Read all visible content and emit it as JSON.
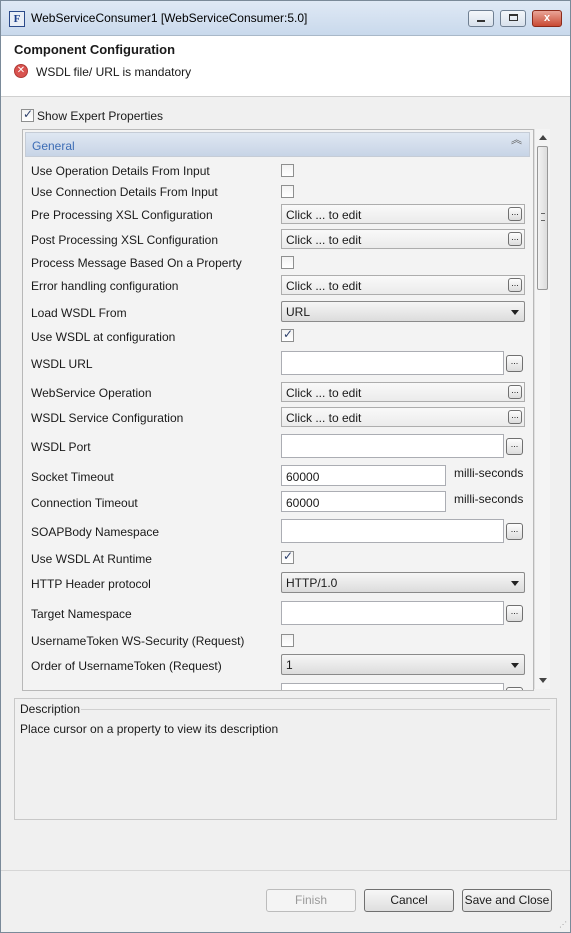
{
  "window": {
    "title": "WebServiceConsumer1 [WebServiceConsumer:5.0]",
    "app_icon_letter": "F",
    "controls": {
      "minimize": "minimize",
      "maximize": "maximize",
      "close": "x"
    }
  },
  "header": {
    "title": "Component Configuration",
    "error_message": "WSDL file/ URL is mandatory",
    "error_icon": "error-x-icon"
  },
  "expert": {
    "label": "Show Expert Properties",
    "checked": true
  },
  "section": {
    "title": "General",
    "collapse_icon": "double-chevron-up-icon"
  },
  "properties": [
    {
      "label": "Use Operation Details From Input",
      "type": "checkbox",
      "checked": false
    },
    {
      "label": "Use Connection Details From Input",
      "type": "checkbox",
      "checked": false
    },
    {
      "label": "Pre Processing XSL Configuration",
      "type": "edit",
      "value": "Click ... to edit"
    },
    {
      "label": "Post Processing XSL Configuration",
      "type": "edit",
      "value": "Click ... to edit"
    },
    {
      "label": "Process Message Based On a Property",
      "type": "checkbox",
      "checked": false
    },
    {
      "label": "Error handling configuration",
      "type": "edit",
      "value": "Click ... to edit"
    },
    {
      "label": "Load WSDL From",
      "type": "select",
      "value": "URL"
    },
    {
      "label": "Use WSDL at configuration",
      "type": "checkbox",
      "checked": true
    },
    {
      "label": "WSDL URL",
      "type": "text",
      "value": ""
    },
    {
      "label": "WebService Operation",
      "type": "edit",
      "value": "Click ... to edit"
    },
    {
      "label": "WSDL Service Configuration",
      "type": "edit",
      "value": "Click ... to edit"
    },
    {
      "label": "WSDL Port",
      "type": "text",
      "value": ""
    },
    {
      "label": "Socket Timeout",
      "type": "number",
      "value": "60000",
      "unit": "milli-seconds"
    },
    {
      "label": "Connection Timeout",
      "type": "number",
      "value": "60000",
      "unit": "milli-seconds"
    },
    {
      "label": "SOAPBody Namespace",
      "type": "text",
      "value": ""
    },
    {
      "label": "Use WSDL At Runtime",
      "type": "checkbox",
      "checked": true
    },
    {
      "label": "HTTP Header protocol",
      "type": "select",
      "value": "HTTP/1.0"
    },
    {
      "label": "Target Namespace",
      "type": "text",
      "value": ""
    },
    {
      "label": "UsernameToken WS-Security (Request)",
      "type": "checkbox",
      "checked": false
    },
    {
      "label": "Order of UsernameToken (Request)",
      "type": "select",
      "value": "1"
    }
  ],
  "ellipsis": "...",
  "description": {
    "title": "Description",
    "text": "Place cursor on a property to view its description"
  },
  "buttons": {
    "finish": "Finish",
    "cancel": "Cancel",
    "save_close": "Save and Close"
  }
}
